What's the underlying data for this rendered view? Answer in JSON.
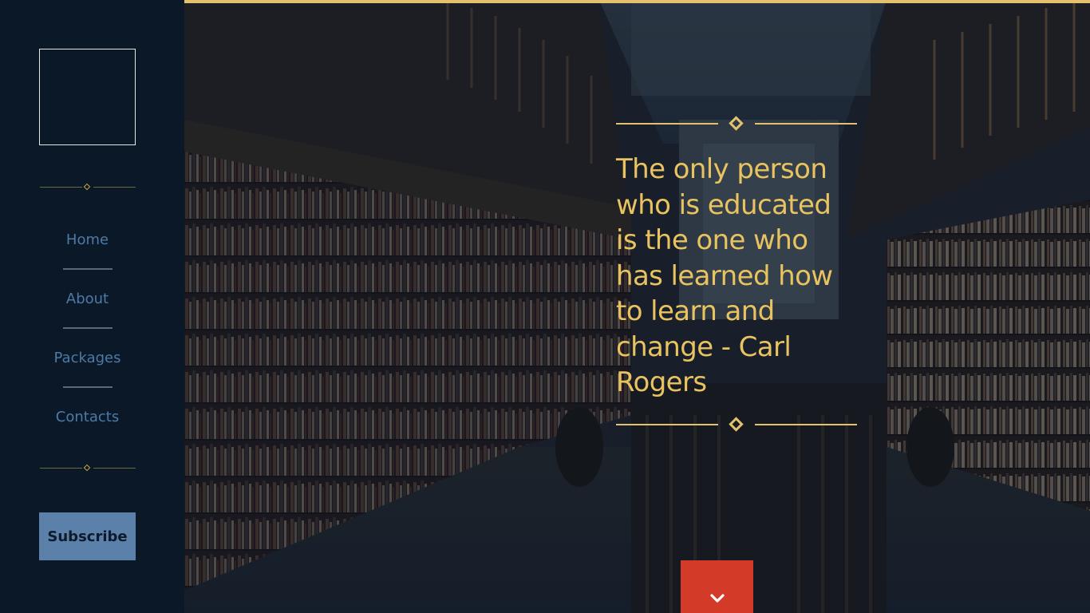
{
  "sidebar": {
    "nav": [
      {
        "label": "Home"
      },
      {
        "label": "About"
      },
      {
        "label": "Packages"
      },
      {
        "label": "Contacts"
      }
    ],
    "subscribe_label": "Subscribe"
  },
  "hero": {
    "quote": "The only person who is educated is the one who has learned how to learn and change - Carl Rogers",
    "scroll_icon": "chevron-down-icon",
    "background_description_icon": "library-image"
  },
  "colors": {
    "accent_gold": "#e3c16f",
    "sidebar_bg": "#0a1827",
    "nav_text": "#4d7aa6",
    "subscribe_bg": "#5b81aa",
    "scroll_button": "#d43a28"
  }
}
